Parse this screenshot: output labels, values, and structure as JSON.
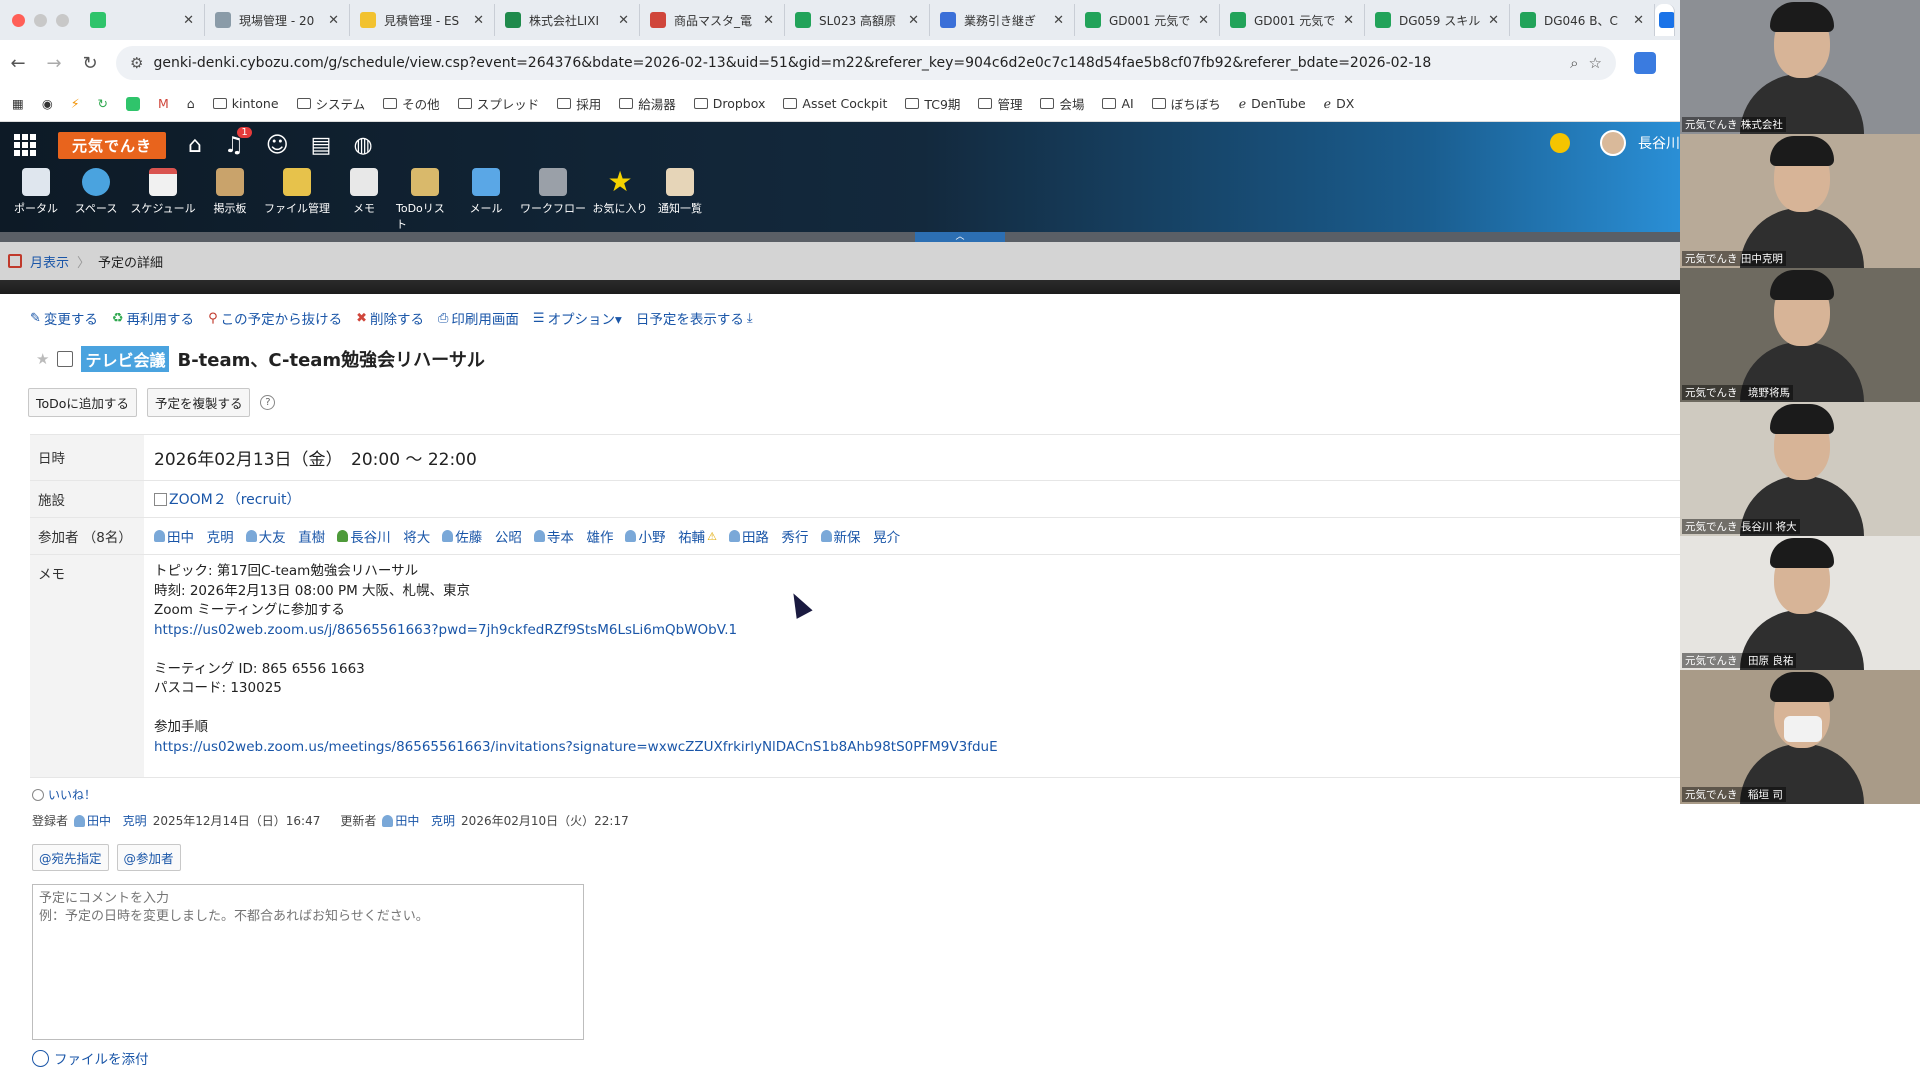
{
  "tabs": [
    {
      "label": "",
      "color": "#2fc46b"
    },
    {
      "label": "現場管理 - 20",
      "color": "#8a9ba8"
    },
    {
      "label": "見積管理 - ES",
      "color": "#f2c230"
    },
    {
      "label": "株式会社LIXI",
      "color": "#1f8a4c"
    },
    {
      "label": "商品マスタ_電",
      "color": "#d0463b"
    },
    {
      "label": "SL023 高額原",
      "color": "#22a35a"
    },
    {
      "label": "業務引き継ぎ",
      "color": "#3a6fd8"
    },
    {
      "label": "GD001 元気で",
      "color": "#22a35a"
    },
    {
      "label": "GD001 元気で",
      "color": "#22a35a"
    },
    {
      "label": "DG059 スキル",
      "color": "#22a35a"
    },
    {
      "label": "DG046 B、C",
      "color": "#22a35a"
    }
  ],
  "address": {
    "url": "genki-denki.cybozu.com/g/schedule/view.csp?event=264376&bdate=2026-02-13&uid=51&gid=m22&referer_key=904c6d2e0c7c148d54fae5b8cf07fb92&referer_bdate=2026-02-18"
  },
  "bookmarks": [
    "kintone",
    "システム",
    "その他",
    "スプレッド",
    "採用",
    "給湯器",
    "Dropbox",
    "Asset Cockpit",
    "TC9期",
    "管理",
    "会場",
    "AI",
    "ぼちぼち",
    "DenTube",
    "DX"
  ],
  "header": {
    "logo": "元気でんき",
    "notification_count": "1",
    "user_name": "長谷川",
    "apps": [
      "ポータル",
      "スペース",
      "スケジュール",
      "掲示板",
      "ファイル管理",
      "メモ",
      "ToDoリスト",
      "メール",
      "ワークフロー",
      "お気に入り",
      "通知一覧"
    ]
  },
  "breadcrumb": {
    "month_view": "月表示",
    "current": "予定の詳細"
  },
  "actions": [
    "変更する",
    "再利用する",
    "この予定から抜ける",
    "削除する",
    "印刷用画面",
    "オプション▾",
    "日予定を表示する"
  ],
  "event": {
    "tag": "テレビ会議",
    "title": "B-team、C-team勉強会リハーサル",
    "todo_button": "ToDoに追加する",
    "copy_button": "予定を複製する",
    "labels": {
      "date": "日時",
      "facility": "施設",
      "participants": "参加者 （8名）",
      "memo": "メモ"
    },
    "date": "2026年02月13日（金）　20:00 ～ 22:00",
    "facility": "ZOOM２（recruit）",
    "participants": [
      {
        "last": "田中",
        "first": "克明"
      },
      {
        "last": "大友",
        "first": "直樹"
      },
      {
        "last": "長谷川",
        "first": "将大"
      },
      {
        "last": "佐藤",
        "first": "公昭"
      },
      {
        "last": "寺本",
        "first": "雄作"
      },
      {
        "last": "小野",
        "first": "祐輔"
      },
      {
        "last": "田路",
        "first": "秀行"
      },
      {
        "last": "新保",
        "first": "晃介"
      }
    ],
    "memo": {
      "topic": "トピック: 第17回C-team勉強会リハーサル",
      "time": "時刻: 2026年2月13日 08:00 PM 大阪、札幌、東京",
      "join": "Zoom ミーティングに参加する",
      "join_url": "https://us02web.zoom.us/j/86565561663?pwd=7jh9ckfedRZf9StsM6LsLi6mQbWObV.1",
      "meeting_id": "ミーティング ID: 865 6556 1663",
      "passcode": "パスコード: 130025",
      "steps": "参加手順",
      "steps_url": "https://us02web.zoom.us/meetings/86565561663/invitations?signature=wxwcZZUXfrkirlyNlDACnS1b8Ahb98tS0PFM9V3fduE"
    }
  },
  "footer": {
    "like": "いいね！",
    "registered_label": "登録者",
    "registered_last": "田中",
    "registered_first": "克明",
    "registered_time": "2025年12月14日（日）16:47",
    "updated_label": "更新者",
    "updated_last": "田中",
    "updated_first": "克明",
    "updated_time": "2026年02月10日（火）22:17",
    "mention_to": "@宛先指定",
    "mention_participants": "@参加者",
    "comment_placeholder": "予定にコメントを入力\n例：予定の日時を変更しました。不都合あればお知らせください。",
    "attach": "ファイルを添付"
  },
  "video_tiles": [
    {
      "name": "元気でんき 株式会社",
      "bg": "#8c8f94",
      "mask": false
    },
    {
      "name": "元気でんき 田中克明",
      "bg": "#b8aa98",
      "mask": false
    },
    {
      "name": "元気でんき　境野将馬",
      "bg": "#6e6a60",
      "mask": false
    },
    {
      "name": "元気でんき 長谷川 将大",
      "bg": "#cfcac0",
      "mask": false
    },
    {
      "name": "元気でんき　田原 良祐",
      "bg": "#e6e4e0",
      "mask": false
    },
    {
      "name": "元気でんき　稲垣 司",
      "bg": "#a99b88",
      "mask": true
    }
  ]
}
